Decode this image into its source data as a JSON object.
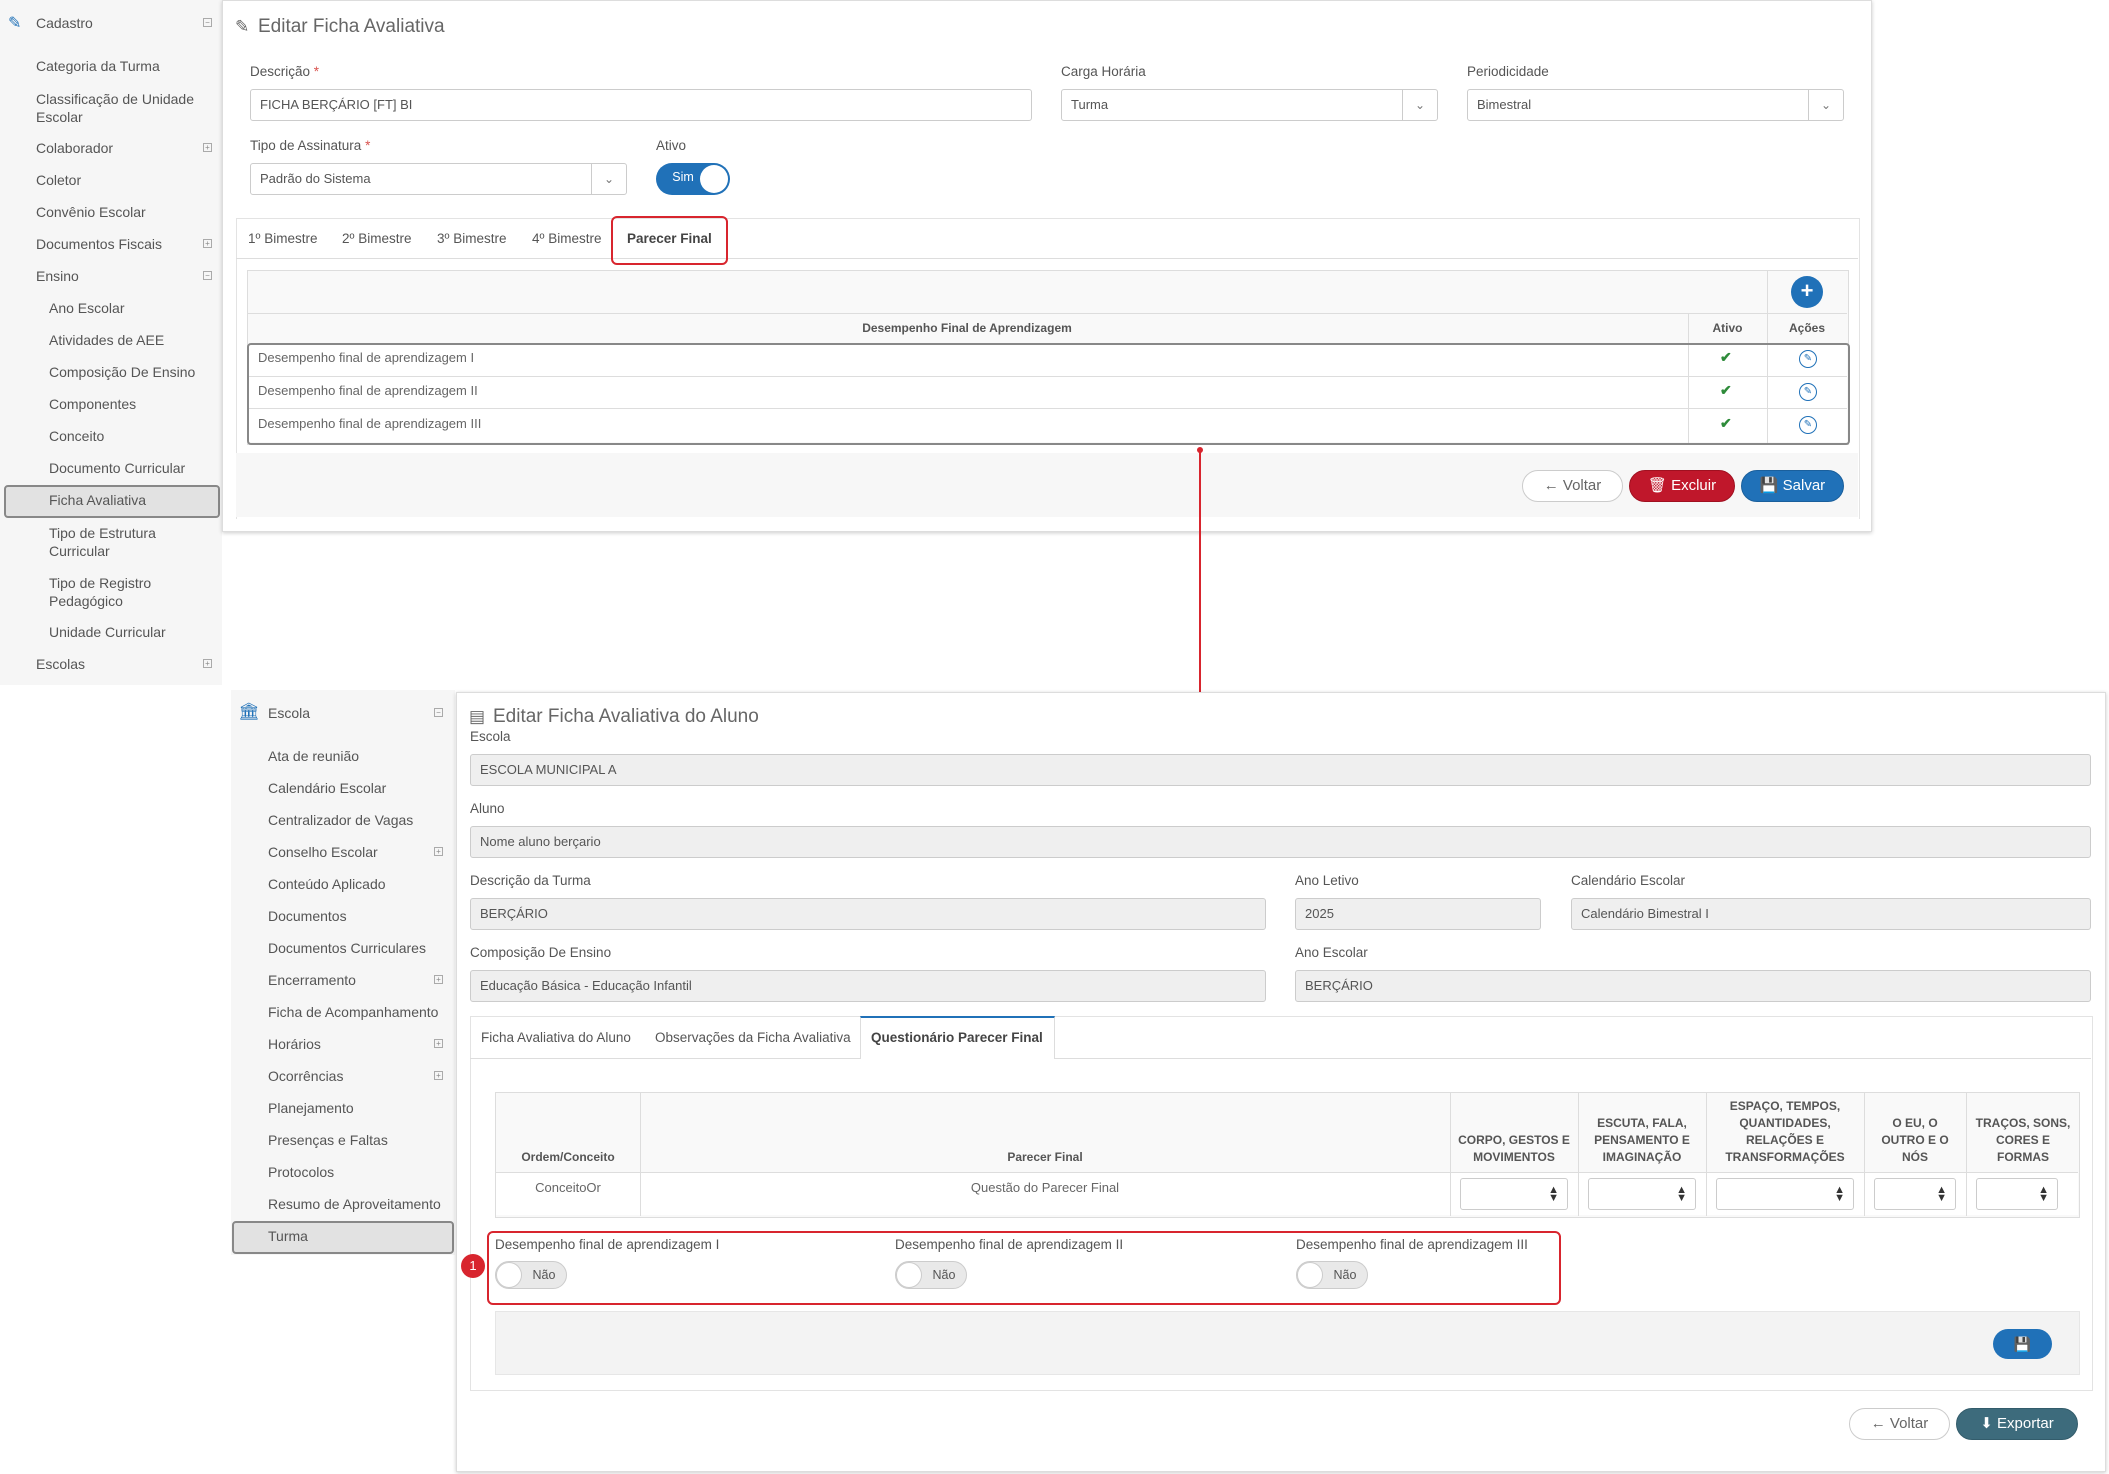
{
  "sidebar1": {
    "section": "Cadastro",
    "items": [
      {
        "label": "Categoria da Turma"
      },
      {
        "label": "Classificação de Unidade Escolar"
      },
      {
        "label": "Colaborador"
      },
      {
        "label": "Coletor"
      },
      {
        "label": "Convênio Escolar"
      },
      {
        "label": "Documentos Fiscais"
      },
      {
        "label": "Ensino"
      },
      {
        "label": "Ano Escolar"
      },
      {
        "label": "Atividades de AEE"
      },
      {
        "label": "Composição De Ensino"
      },
      {
        "label": "Componentes"
      },
      {
        "label": "Conceito"
      },
      {
        "label": "Documento Curricular"
      },
      {
        "label": "Ficha Avaliativa"
      },
      {
        "label": "Tipo de Estrutura Curricular"
      },
      {
        "label": "Tipo de Registro Pedagógico"
      },
      {
        "label": "Unidade Curricular"
      },
      {
        "label": "Escolas"
      }
    ]
  },
  "form1": {
    "title": "Editar Ficha Avaliativa",
    "descricao_label": "Descrição",
    "required_mark": "*",
    "descricao_value": "FICHA BERÇÁRIO [FT] BI",
    "carga_label": "Carga Horária",
    "carga_value": "Turma",
    "periodicidade_label": "Periodicidade",
    "periodicidade_value": "Bimestral",
    "assinatura_label": "Tipo de Assinatura",
    "assinatura_value": "Padrão do Sistema",
    "ativo_label": "Ativo",
    "ativo_value": "Sim",
    "tabs": [
      "1º Bimestre",
      "2º Bimestre",
      "3º Bimestre",
      "4º Bimestre",
      "Parecer Final"
    ],
    "table": {
      "headers": [
        "Desempenho Final de Aprendizagem",
        "Ativo",
        "Ações"
      ],
      "rows": [
        {
          "desc": "Desempenho final de aprendizagem I"
        },
        {
          "desc": "Desempenho final de aprendizagem II"
        },
        {
          "desc": "Desempenho final de aprendizagem III"
        }
      ]
    },
    "btn_voltar": "Voltar",
    "btn_excluir": "Excluir",
    "btn_salvar": "Salvar"
  },
  "sidebar2": {
    "section": "Escola",
    "items": [
      {
        "label": "Ata de reunião"
      },
      {
        "label": "Calendário Escolar"
      },
      {
        "label": "Centralizador de Vagas"
      },
      {
        "label": "Conselho Escolar"
      },
      {
        "label": "Conteúdo Aplicado"
      },
      {
        "label": "Documentos"
      },
      {
        "label": "Documentos Curriculares"
      },
      {
        "label": "Encerramento"
      },
      {
        "label": "Ficha de Acompanhamento"
      },
      {
        "label": "Horários"
      },
      {
        "label": "Ocorrências"
      },
      {
        "label": "Planejamento"
      },
      {
        "label": "Presenças e Faltas"
      },
      {
        "label": "Protocolos"
      },
      {
        "label": "Resumo de Aproveitamento"
      },
      {
        "label": "Turma"
      }
    ]
  },
  "form2": {
    "title": "Editar Ficha Avaliativa do Aluno",
    "escola_label": "Escola",
    "escola_value": "ESCOLA MUNICIPAL A",
    "aluno_label": "Aluno",
    "aluno_value": "Nome aluno berçario",
    "turma_label": "Descrição da Turma",
    "turma_value": "BERÇÁRIO",
    "ano_letivo_label": "Ano Letivo",
    "ano_letivo_value": "2025",
    "calendario_label": "Calendário Escolar",
    "calendario_value": "Calendário Bimestral I",
    "composicao_label": "Composição De Ensino",
    "composicao_value": "Educação Básica - Educação Infantil",
    "ano_escolar_label": "Ano Escolar",
    "ano_escolar_value": "BERÇÁRIO",
    "tabs": [
      "Ficha Avaliativa do Aluno",
      "Observações da Ficha Avaliativa",
      "Questionário Parecer Final"
    ],
    "table": {
      "headers": [
        "Ordem/Conceito",
        "Parecer Final",
        "CORPO, GESTOS E MOVIMENTOS",
        "ESCUTA, FALA, PENSAMENTO E IMAGINAÇÃO",
        "ESPAÇO, TEMPOS, QUANTIDADES, RELAÇÕES E TRANSFORMAÇÕES",
        "O EU, O OUTRO E O NÓS",
        "TRAÇOS, SONS, CORES E FORMAS"
      ],
      "row_conceito": "ConceitoOr",
      "row_parecer": "Questão do Parecer Final"
    },
    "toggles": [
      {
        "label": "Desempenho final de aprendizagem I",
        "value": "Não"
      },
      {
        "label": "Desempenho final de aprendizagem II",
        "value": "Não"
      },
      {
        "label": "Desempenho final de aprendizagem III",
        "value": "Não"
      }
    ],
    "marker": "1",
    "btn_voltar": "Voltar",
    "btn_exportar": "Exportar"
  },
  "colors": {
    "accent": "#2071b8",
    "danger": "#c0172b",
    "highlight": "#d8252e",
    "teal": "#3d6b7c"
  }
}
